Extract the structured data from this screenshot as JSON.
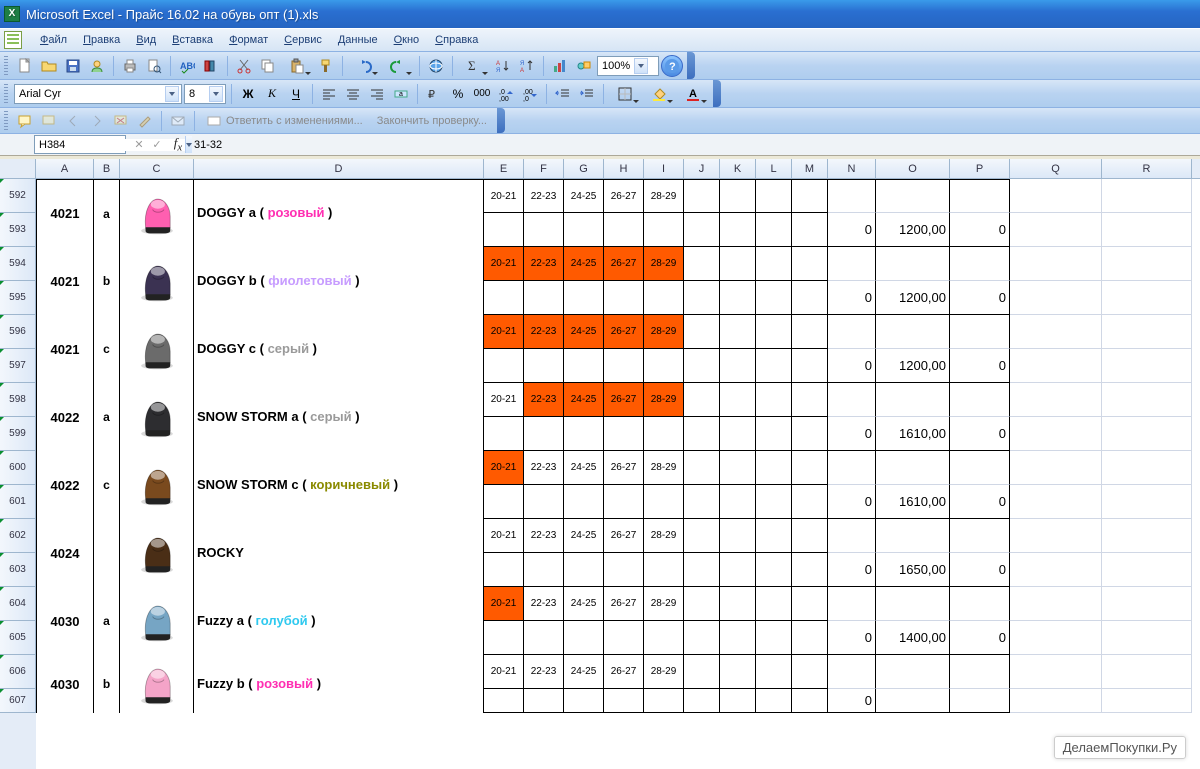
{
  "title": "Microsoft Excel - Прайс 16.02 на обувь опт  (1).xls",
  "menus": [
    "Файл",
    "Правка",
    "Вид",
    "Вставка",
    "Формат",
    "Сервис",
    "Данные",
    "Окно",
    "Справка"
  ],
  "toolbar1": {
    "font": "Arial Cyr",
    "fontsize": "8",
    "zoom": "100%",
    "review1": "Ответить с изменениями...",
    "review2": "Закончить проверку..."
  },
  "namebox": "H384",
  "formula": "31-32",
  "columns": [
    "A",
    "B",
    "C",
    "D",
    "E",
    "F",
    "G",
    "H",
    "I",
    "J",
    "K",
    "L",
    "M",
    "N",
    "O",
    "P",
    "Q",
    "R"
  ],
  "row_numbers": [
    "592",
    "593",
    "594",
    "595",
    "596",
    "597",
    "598",
    "599",
    "600",
    "601",
    "602",
    "603",
    "604",
    "605",
    "606",
    "607"
  ],
  "sizes": [
    "20-21",
    "22-23",
    "24-25",
    "26-27",
    "28-29"
  ],
  "products": [
    {
      "code": "4021",
      "v": "a",
      "name": "DOGGY a",
      "color_lbl": "розовый",
      "color_css": "#ff2fb2",
      "hl": [
        0,
        0,
        0,
        0,
        0
      ],
      "n": "0",
      "price": "1200,00",
      "p": "0",
      "shoe": "#ff5fb0"
    },
    {
      "code": "4021",
      "v": "b",
      "name": "DOGGY b",
      "color_lbl": "фиолетовый",
      "color_css": "#c79cff",
      "hl": [
        1,
        1,
        1,
        1,
        1
      ],
      "n": "0",
      "price": "1200,00",
      "p": "0",
      "shoe": "#3b3252"
    },
    {
      "code": "4021",
      "v": "c",
      "name": "DOGGY c",
      "color_lbl": "серый",
      "color_css": "#9a9a9a",
      "hl": [
        1,
        1,
        1,
        1,
        1
      ],
      "n": "0",
      "price": "1200,00",
      "p": "0",
      "shoe": "#6b6b6b"
    },
    {
      "code": "4022",
      "v": "a",
      "name": "SNOW STORM a",
      "color_lbl": "серый",
      "color_css": "#9a9a9a",
      "hl": [
        0,
        1,
        1,
        1,
        1
      ],
      "n": "0",
      "price": "1610,00",
      "p": "0",
      "shoe": "#2d2d30"
    },
    {
      "code": "4022",
      "v": "c",
      "name": "SNOW STORM c",
      "color_lbl": "коричневый",
      "color_css": "#8a8a00",
      "hl": [
        1,
        0,
        0,
        0,
        0
      ],
      "n": "0",
      "price": "1610,00",
      "p": "0",
      "shoe": "#7a4a1e"
    },
    {
      "code": "4024",
      "v": "",
      "name": "ROCKY",
      "color_lbl": "",
      "color_css": "",
      "hl": [
        0,
        0,
        0,
        0,
        0
      ],
      "n": "0",
      "price": "1650,00",
      "p": "0",
      "shoe": "#4a2e16"
    },
    {
      "code": "4030",
      "v": "a",
      "name": "Fuzzy a",
      "color_lbl": "голубой",
      "color_css": "#2fc9ef",
      "hl": [
        1,
        0,
        0,
        0,
        0
      ],
      "n": "0",
      "price": "1400,00",
      "p": "0",
      "shoe": "#76a5c4"
    },
    {
      "code": "4030",
      "v": "b",
      "name": "Fuzzy  b",
      "color_lbl": "розовый",
      "color_css": "#ff2fb2",
      "hl": [
        0,
        0,
        0,
        0,
        0
      ],
      "n": "0",
      "price": "",
      "p": "",
      "shoe": "#f4a4c8"
    }
  ],
  "watermark": "ДелаемПокупки.Ру"
}
